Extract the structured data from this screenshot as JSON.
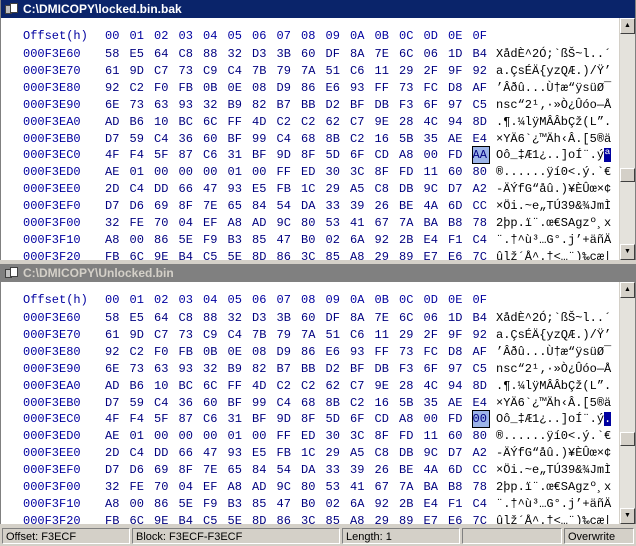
{
  "top_pane": {
    "title": "C:\\DMICOPY\\locked.bin.bak",
    "header": {
      "label": "Offset(h)",
      "columns": [
        "00",
        "01",
        "02",
        "03",
        "04",
        "05",
        "06",
        "07",
        "08",
        "09",
        "0A",
        "0B",
        "0C",
        "0D",
        "0E",
        "0F"
      ]
    },
    "rows": [
      {
        "offset": "000F3E60",
        "bytes": [
          "58",
          "E5",
          "64",
          "C8",
          "88",
          "32",
          "D3",
          "3B",
          "60",
          "DF",
          "8A",
          "7E",
          "6C",
          "06",
          "1D",
          "B4"
        ],
        "ascii": "XådÈ^2Ó;`ßŠ~l..´"
      },
      {
        "offset": "000F3E70",
        "bytes": [
          "61",
          "9D",
          "C7",
          "73",
          "C9",
          "C4",
          "7B",
          "79",
          "7A",
          "51",
          "C6",
          "11",
          "29",
          "2F",
          "9F",
          "92"
        ],
        "ascii": "a.ÇsÉÄ{yzQÆ.)/Ÿ’"
      },
      {
        "offset": "000F3E80",
        "bytes": [
          "92",
          "C2",
          "F0",
          "FB",
          "0B",
          "0E",
          "08",
          "D9",
          "86",
          "E6",
          "93",
          "FF",
          "73",
          "FC",
          "D8",
          "AF"
        ],
        "ascii": "’Âðû...Ù†æ“ÿsüØ¯"
      },
      {
        "offset": "000F3E90",
        "bytes": [
          "6E",
          "73",
          "63",
          "93",
          "32",
          "B9",
          "82",
          "B7",
          "BB",
          "D2",
          "BF",
          "DB",
          "F3",
          "6F",
          "97",
          "C5"
        ],
        "ascii": "nsc“2¹‚·»Ò¿Ûóo—Å"
      },
      {
        "offset": "000F3EA0",
        "bytes": [
          "AD",
          "B6",
          "10",
          "BC",
          "6C",
          "FF",
          "4D",
          "C2",
          "C2",
          "62",
          "C7",
          "9E",
          "28",
          "4C",
          "94",
          "8D"
        ],
        "ascii": ".¶.¼lÿMÂÂbÇž(L”."
      },
      {
        "offset": "000F3EB0",
        "bytes": [
          "D7",
          "59",
          "C4",
          "36",
          "60",
          "BF",
          "99",
          "C4",
          "68",
          "8B",
          "C2",
          "16",
          "5B",
          "35",
          "AE",
          "E4"
        ],
        "ascii": "×YÄ6`¿™Äh‹Â.[5®ä"
      },
      {
        "offset": "000F3EC0",
        "bytes": [
          "4F",
          "F4",
          "5F",
          "87",
          "C6",
          "31",
          "BF",
          "9D",
          "8F",
          "5D",
          "6F",
          "CD",
          "A8",
          "00",
          "FD",
          "AA"
        ],
        "ascii": "Oô_‡Æ1¿..]oÍ¨.ýª"
      },
      {
        "offset": "000F3ED0",
        "bytes": [
          "AE",
          "01",
          "00",
          "00",
          "00",
          "01",
          "00",
          "FF",
          "ED",
          "30",
          "3C",
          "8F",
          "FD",
          "11",
          "60",
          "80"
        ],
        "ascii": "®......ÿí0<.ý.`€"
      },
      {
        "offset": "000F3EE0",
        "bytes": [
          "2D",
          "C4",
          "DD",
          "66",
          "47",
          "93",
          "E5",
          "FB",
          "1C",
          "29",
          "A5",
          "C8",
          "DB",
          "9C",
          "D7",
          "A2"
        ],
        "ascii": "-ÄÝfG“åû.)¥ÈÛœ×¢"
      },
      {
        "offset": "000F3EF0",
        "bytes": [
          "D7",
          "D6",
          "69",
          "8F",
          "7E",
          "65",
          "84",
          "54",
          "DA",
          "33",
          "39",
          "26",
          "BE",
          "4A",
          "6D",
          "CC"
        ],
        "ascii": "×Öi.~e„TÚ39&¾JmÌ"
      },
      {
        "offset": "000F3F00",
        "bytes": [
          "32",
          "FE",
          "70",
          "04",
          "EF",
          "A8",
          "AD",
          "9C",
          "80",
          "53",
          "41",
          "67",
          "7A",
          "BA",
          "B8",
          "78"
        ],
        "ascii": "2þp.ï¨.œ€SAgzº¸x"
      },
      {
        "offset": "000F3F10",
        "bytes": [
          "A8",
          "00",
          "86",
          "5E",
          "F9",
          "B3",
          "85",
          "47",
          "B0",
          "02",
          "6A",
          "92",
          "2B",
          "E4",
          "F1",
          "C4"
        ],
        "ascii": "¨.†^ù³…G°.j’+äñÄ"
      },
      {
        "offset": "000F3F20",
        "bytes": [
          "FB",
          "6C",
          "9E",
          "B4",
          "C5",
          "5E",
          "8D",
          "86",
          "3C",
          "85",
          "A8",
          "29",
          "89",
          "E7",
          "E6",
          "7C"
        ],
        "ascii": "ûlž´Å^.†<…¨)‰çæ|"
      }
    ],
    "selected_byte": {
      "row": 6,
      "col": 15,
      "value": "AA"
    }
  },
  "bottom_pane": {
    "title": "C:\\DMICOPY\\Unlocked.bin",
    "header": {
      "label": "Offset(h)",
      "columns": [
        "00",
        "01",
        "02",
        "03",
        "04",
        "05",
        "06",
        "07",
        "08",
        "09",
        "0A",
        "0B",
        "0C",
        "0D",
        "0E",
        "0F"
      ]
    },
    "rows": [
      {
        "offset": "000F3E60",
        "bytes": [
          "58",
          "E5",
          "64",
          "C8",
          "88",
          "32",
          "D3",
          "3B",
          "60",
          "DF",
          "8A",
          "7E",
          "6C",
          "06",
          "1D",
          "B4"
        ],
        "ascii": "XådÈ^2Ó;`ßŠ~l..´"
      },
      {
        "offset": "000F3E70",
        "bytes": [
          "61",
          "9D",
          "C7",
          "73",
          "C9",
          "C4",
          "7B",
          "79",
          "7A",
          "51",
          "C6",
          "11",
          "29",
          "2F",
          "9F",
          "92"
        ],
        "ascii": "a.ÇsÉÄ{yzQÆ.)/Ÿ’"
      },
      {
        "offset": "000F3E80",
        "bytes": [
          "92",
          "C2",
          "F0",
          "FB",
          "0B",
          "0E",
          "08",
          "D9",
          "86",
          "E6",
          "93",
          "FF",
          "73",
          "FC",
          "D8",
          "AF"
        ],
        "ascii": "’Âðû...Ù†æ“ÿsüØ¯"
      },
      {
        "offset": "000F3E90",
        "bytes": [
          "6E",
          "73",
          "63",
          "93",
          "32",
          "B9",
          "82",
          "B7",
          "BB",
          "D2",
          "BF",
          "DB",
          "F3",
          "6F",
          "97",
          "C5"
        ],
        "ascii": "nsc“2¹‚·»Ò¿Ûóo—Å"
      },
      {
        "offset": "000F3EA0",
        "bytes": [
          "AD",
          "B6",
          "10",
          "BC",
          "6C",
          "FF",
          "4D",
          "C2",
          "C2",
          "62",
          "C7",
          "9E",
          "28",
          "4C",
          "94",
          "8D"
        ],
        "ascii": ".¶.¼lÿMÂÂbÇž(L”."
      },
      {
        "offset": "000F3EB0",
        "bytes": [
          "D7",
          "59",
          "C4",
          "36",
          "60",
          "BF",
          "99",
          "C4",
          "68",
          "8B",
          "C2",
          "16",
          "5B",
          "35",
          "AE",
          "E4"
        ],
        "ascii": "×YÄ6`¿™Äh‹Â.[5®ä"
      },
      {
        "offset": "000F3EC0",
        "bytes": [
          "4F",
          "F4",
          "5F",
          "87",
          "C6",
          "31",
          "BF",
          "9D",
          "8F",
          "5D",
          "6F",
          "CD",
          "A8",
          "00",
          "FD",
          "00"
        ],
        "ascii": "Oô_‡Æ1¿..]oÍ¨.ý."
      },
      {
        "offset": "000F3ED0",
        "bytes": [
          "AE",
          "01",
          "00",
          "00",
          "00",
          "01",
          "00",
          "FF",
          "ED",
          "30",
          "3C",
          "8F",
          "FD",
          "11",
          "60",
          "80"
        ],
        "ascii": "®......ÿí0<.ý.`€"
      },
      {
        "offset": "000F3EE0",
        "bytes": [
          "2D",
          "C4",
          "DD",
          "66",
          "47",
          "93",
          "E5",
          "FB",
          "1C",
          "29",
          "A5",
          "C8",
          "DB",
          "9C",
          "D7",
          "A2"
        ],
        "ascii": "-ÄÝfG“åû.)¥ÈÛœ×¢"
      },
      {
        "offset": "000F3EF0",
        "bytes": [
          "D7",
          "D6",
          "69",
          "8F",
          "7E",
          "65",
          "84",
          "54",
          "DA",
          "33",
          "39",
          "26",
          "BE",
          "4A",
          "6D",
          "CC"
        ],
        "ascii": "×Öi.~e„TÚ39&¾JmÌ"
      },
      {
        "offset": "000F3F00",
        "bytes": [
          "32",
          "FE",
          "70",
          "04",
          "EF",
          "A8",
          "AD",
          "9C",
          "80",
          "53",
          "41",
          "67",
          "7A",
          "BA",
          "B8",
          "78"
        ],
        "ascii": "2þp.ï¨.œ€SAgzº¸x"
      },
      {
        "offset": "000F3F10",
        "bytes": [
          "A8",
          "00",
          "86",
          "5E",
          "F9",
          "B3",
          "85",
          "47",
          "B0",
          "02",
          "6A",
          "92",
          "2B",
          "E4",
          "F1",
          "C4"
        ],
        "ascii": "¨.†^ù³…G°.j’+äñÄ"
      },
      {
        "offset": "000F3F20",
        "bytes": [
          "FB",
          "6C",
          "9E",
          "B4",
          "C5",
          "5E",
          "8D",
          "86",
          "3C",
          "85",
          "A8",
          "29",
          "89",
          "E7",
          "E6",
          "7C"
        ],
        "ascii": "ûlž´Å^.†<…¨)‰çæ|"
      }
    ],
    "selected_byte": {
      "row": 6,
      "col": 15,
      "value": "00"
    }
  },
  "status_bar": {
    "offset": "Offset: F3ECF",
    "block": "Block: F3ECF-F3ECF",
    "length": "Length: 1",
    "mode": "Overwrite"
  },
  "colors": {
    "active_title": "#0a246a",
    "inactive_title": "#808080",
    "hex_text": "#000080",
    "selection": "#9cb4e8"
  },
  "icons": {
    "window_icon": "document-window-icon",
    "scroll_up": "scroll-up-arrow-icon",
    "scroll_down": "scroll-down-arrow-icon"
  }
}
